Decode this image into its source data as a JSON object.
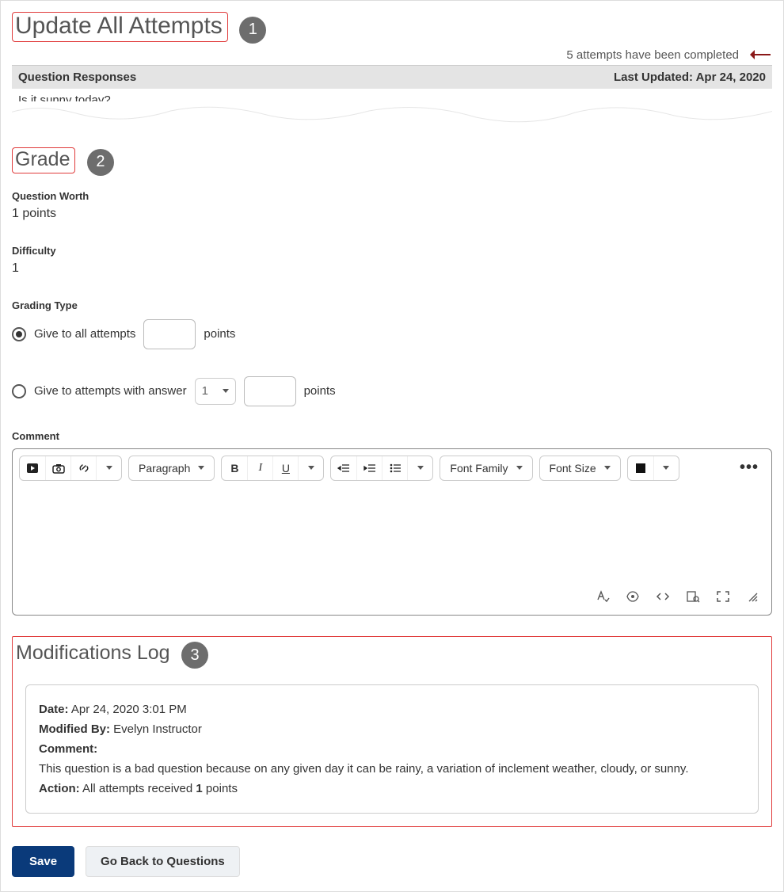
{
  "header": {
    "title": "Update All Attempts",
    "completed_text": "5 attempts have been completed"
  },
  "responses": {
    "left_label": "Question Responses",
    "right_label": "Last Updated: Apr 24, 2020",
    "question_text": "Is it sunny today?"
  },
  "grade": {
    "title": "Grade",
    "worth_label": "Question Worth",
    "worth_value": "1 points",
    "difficulty_label": "Difficulty",
    "difficulty_value": "1",
    "grading_type_label": "Grading Type",
    "opt_all_label": "Give to all attempts",
    "opt_all_points_suffix": "points",
    "opt_answer_label": "Give to attempts with answer",
    "opt_answer_select": "1",
    "opt_answer_points_suffix": "points",
    "comment_label": "Comment"
  },
  "editor": {
    "paragraph": "Paragraph",
    "font_family": "Font Family",
    "font_size": "Font Size"
  },
  "modlog": {
    "title": "Modifications Log",
    "date_label": "Date:",
    "date_value": "Apr 24, 2020 3:01 PM",
    "modified_by_label": "Modified By:",
    "modified_by_value": "Evelyn Instructor",
    "comment_label": "Comment:",
    "comment_value": "This question is a bad question because on any given day it can be rainy, a variation of inclement weather, cloudy, or sunny.",
    "action_label": "Action:",
    "action_prefix": "All attempts received ",
    "action_bold": "1",
    "action_suffix": " points"
  },
  "buttons": {
    "save": "Save",
    "back": "Go Back to Questions"
  },
  "callouts": {
    "c1": "1",
    "c2": "2",
    "c3": "3"
  }
}
